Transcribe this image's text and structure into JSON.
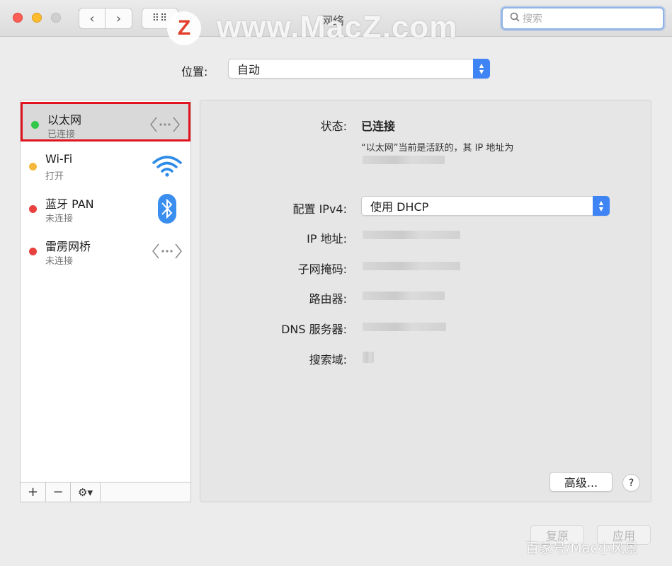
{
  "window": {
    "title": "网络",
    "search_placeholder": "搜索",
    "watermark": "www.MacZ.com",
    "watermark_logo": "Z",
    "footer_watermark": "百家号/Mac小风景"
  },
  "location": {
    "label": "位置:",
    "value": "自动"
  },
  "services": [
    {
      "name": "以太网",
      "status": "已连接",
      "dot_color": "#34c84a",
      "icon": "ethernet-icon",
      "selected": true
    },
    {
      "name": "Wi-Fi",
      "status": "打开",
      "dot_color": "#f5b83d",
      "icon": "wifi-icon",
      "selected": false
    },
    {
      "name": "蓝牙 PAN",
      "status": "未连接",
      "dot_color": "#e8413f",
      "icon": "bluetooth-icon",
      "selected": false
    },
    {
      "name": "雷雳网桥",
      "status": "未连接",
      "dot_color": "#e8413f",
      "icon": "thunderbolt-bridge-icon",
      "selected": false
    }
  ],
  "sidebar_buttons": {
    "add": "+",
    "remove": "−",
    "action": "⚙▾"
  },
  "detail": {
    "status_label": "状态:",
    "status_value": "已连接",
    "status_desc": "“以太网”当前是活跃的，其 IP 地址为",
    "config_label": "配置 IPv4:",
    "config_value": "使用 DHCP",
    "ip_label": "IP 地址:",
    "subnet_label": "子网掩码:",
    "router_label": "路由器:",
    "dns_label": "DNS 服务器:",
    "search_domain_label": "搜索域:"
  },
  "buttons": {
    "advanced": "高级...",
    "help": "?",
    "revert": "复原",
    "apply": "应用"
  },
  "colors": {
    "accent": "#3f84f5",
    "selection_outline": "#e0141f"
  }
}
